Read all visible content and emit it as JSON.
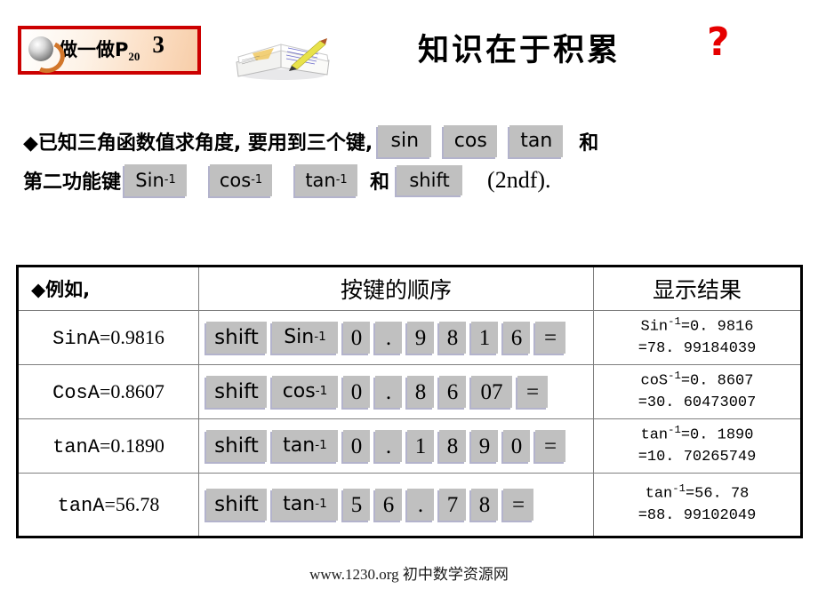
{
  "badge": {
    "icon": "globe-arrow-icon",
    "label": "做一做P",
    "subscript": "20",
    "number": "3",
    "border_color": "#cc0000"
  },
  "book_image": {
    "icon": "open-book-with-pencil-image"
  },
  "title": {
    "text": "知识在于积累",
    "question_mark": "?",
    "question_mark_color": "#e60000"
  },
  "body": {
    "line1_prefix": "◆已知三角函数值求角度, 要用到三个键,",
    "line1_keys": [
      "sin",
      "cos",
      "tan"
    ],
    "line1_suffix": "和",
    "line2_prefix": "第二功能键",
    "line2_keys": [
      "Sin",
      "cos",
      "tan"
    ],
    "key_exponent": "-1",
    "line2_conj": "和",
    "shift_key": "shift",
    "line2_suffix": "(2ndf)."
  },
  "table": {
    "headers": [
      "◆例如,",
      "按键的顺序",
      "显示结果"
    ],
    "rows": [
      {
        "example_mono": "SinA",
        "example_rest": "=0.9816",
        "keys": [
          "shift",
          "Sin",
          "0",
          ".",
          "9",
          "8",
          "1",
          "6",
          "="
        ],
        "inverse_exponent": "-1",
        "result_line1_fn": "Sin",
        "result_line1_exp": "-1",
        "result_line1_rest": "=0. 9816",
        "result_line2": "=78. 99184039"
      },
      {
        "example_mono": "CosA",
        "example_rest": "=0.8607",
        "keys": [
          "shift",
          "cos",
          "0",
          ".",
          "8",
          "6",
          "07",
          "="
        ],
        "inverse_exponent": "-1",
        "result_line1_fn": "coS",
        "result_line1_exp": "-1",
        "result_line1_rest": "=0. 8607",
        "result_line2": "=30. 60473007"
      },
      {
        "example_mono": "tanA",
        "example_rest": "=0.1890",
        "keys": [
          "shift",
          "tan",
          "0",
          ".",
          "1",
          "8",
          "9",
          "0",
          "="
        ],
        "inverse_exponent": "-1",
        "result_line1_fn": "tan",
        "result_line1_exp": "-1",
        "result_line1_rest": "=0. 1890",
        "result_line2": "=10. 70265749"
      },
      {
        "example_mono": "tanA",
        "example_rest": "=56.78",
        "keys": [
          "shift",
          "tan",
          "5",
          "6",
          ".",
          "7",
          "8",
          "="
        ],
        "inverse_exponent": "-1",
        "result_line1_fn": "tan",
        "result_line1_exp": "-1",
        "result_line1_rest": "=56. 78",
        "result_line2": "=88. 99102049"
      }
    ]
  },
  "footer": {
    "text": "www.1230.org 初中数学资源网"
  },
  "colors": {
    "key_gray": "#c0c0c0",
    "key_shadow": "#b3b3cc",
    "table_border": "#000000"
  }
}
